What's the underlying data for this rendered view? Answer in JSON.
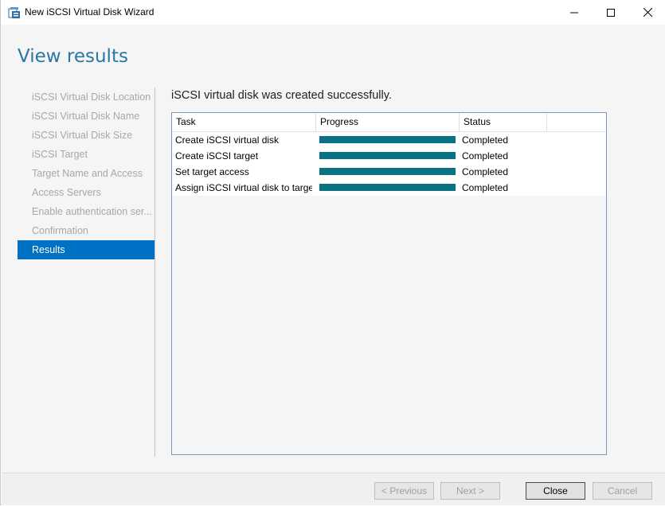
{
  "window": {
    "title": "New iSCSI Virtual Disk Wizard"
  },
  "page": {
    "heading": "View results",
    "success_message": "iSCSI virtual disk was created successfully."
  },
  "nav": {
    "items": [
      {
        "label": "iSCSI Virtual Disk Location"
      },
      {
        "label": "iSCSI Virtual Disk Name"
      },
      {
        "label": "iSCSI Virtual Disk Size"
      },
      {
        "label": "iSCSI Target"
      },
      {
        "label": "Target Name and Access"
      },
      {
        "label": "Access Servers"
      },
      {
        "label": "Enable authentication ser..."
      },
      {
        "label": "Confirmation"
      },
      {
        "label": "Results"
      }
    ],
    "active_index": 8
  },
  "results": {
    "columns": [
      "Task",
      "Progress",
      "Status"
    ],
    "rows": [
      {
        "task": "Create iSCSI virtual disk",
        "progress": 1.0,
        "status": "Completed"
      },
      {
        "task": "Create iSCSI target",
        "progress": 1.0,
        "status": "Completed"
      },
      {
        "task": "Set target access",
        "progress": 1.0,
        "status": "Completed"
      },
      {
        "task": "Assign iSCSI virtual disk to target",
        "progress": 1.0,
        "status": "Completed"
      }
    ]
  },
  "buttons": {
    "previous": "< Previous",
    "next": "Next >",
    "close": "Close",
    "cancel": "Cancel"
  },
  "colors": {
    "accent": "#0072c6",
    "heading": "#2a77a6",
    "progress": "#0a7383"
  }
}
